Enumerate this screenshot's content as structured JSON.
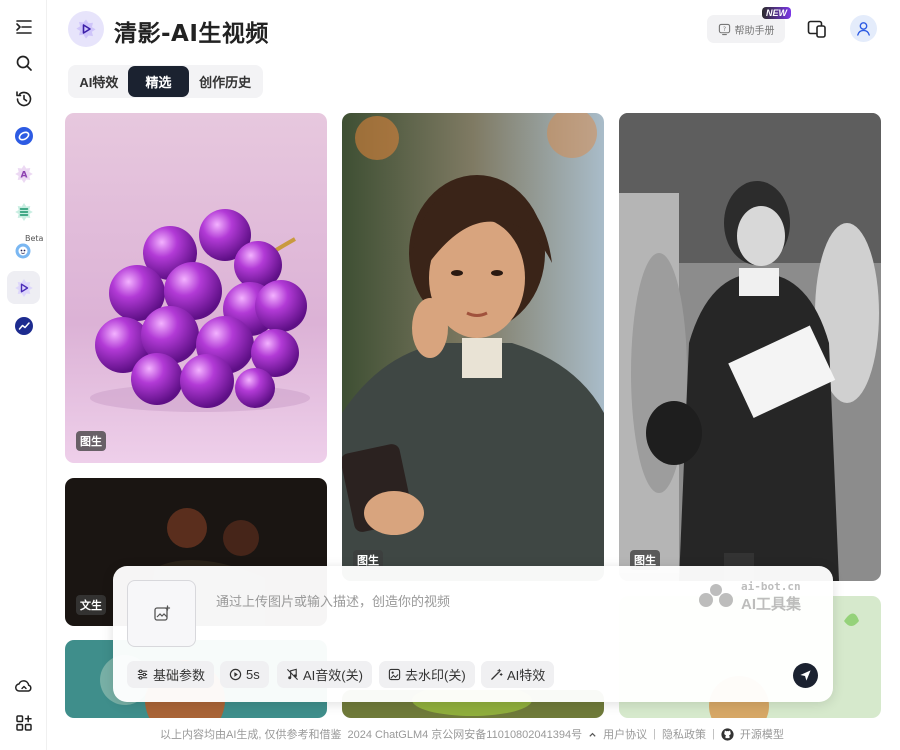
{
  "app": {
    "title": "清影-AI生视频"
  },
  "header": {
    "help_label": "帮助手册",
    "new_badge": "NEW"
  },
  "sidebar": {
    "beta_badge": "Beta",
    "items": [
      {
        "icon": "menu-expand-icon"
      },
      {
        "icon": "search-icon"
      },
      {
        "icon": "history-icon"
      },
      {
        "icon": "chatglm-app-icon"
      },
      {
        "icon": "ai-create-app-icon"
      },
      {
        "icon": "list-app-icon"
      },
      {
        "icon": "bot-app-icon"
      },
      {
        "icon": "qingying-video-app-icon"
      },
      {
        "icon": "analytics-app-icon"
      },
      {
        "icon": "cloud-sync-icon"
      },
      {
        "icon": "apps-grid-icon"
      }
    ]
  },
  "tabs": [
    {
      "label": "AI特效"
    },
    {
      "label": "精选"
    },
    {
      "label": "创作历史"
    }
  ],
  "active_tab": "精选",
  "cards": [
    {
      "badge": "图生",
      "subject": "purple grapes"
    },
    {
      "badge": "文生",
      "subject": "flowers"
    },
    {
      "badge": "图生",
      "subject": "woman with phone"
    },
    {
      "badge": "图生",
      "subject": "woman walking"
    },
    {
      "badge": "文生",
      "subject": "garden"
    }
  ],
  "prompt": {
    "placeholder": "通过上传图片或输入描述，创造你的视频",
    "watermark_small": "ai-bot.cn",
    "watermark_big": "AI工具集"
  },
  "chips": [
    {
      "label": "基础参数",
      "icon": "sliders-icon"
    },
    {
      "label": "5s",
      "icon": "clock-icon"
    },
    {
      "label": "AI音效(关)",
      "icon": "music-off-icon"
    },
    {
      "label": "去水印(关)",
      "icon": "image-watermark-icon"
    },
    {
      "label": "AI特效",
      "icon": "magic-wand-icon"
    }
  ],
  "footer": {
    "disclaimer": "以上内容均由AI生成, 仅供参考和借鉴",
    "copyright": "2024 ChatGLM4 京公网安备11010802041394号",
    "user_agreement": "用户协议",
    "privacy": "隐私政策",
    "open_source": "开源模型"
  },
  "colors": {
    "active_tab_bg": "#1b2230",
    "brand_purple": "#7b36e8",
    "logo_bg": "#e7e4fb"
  }
}
